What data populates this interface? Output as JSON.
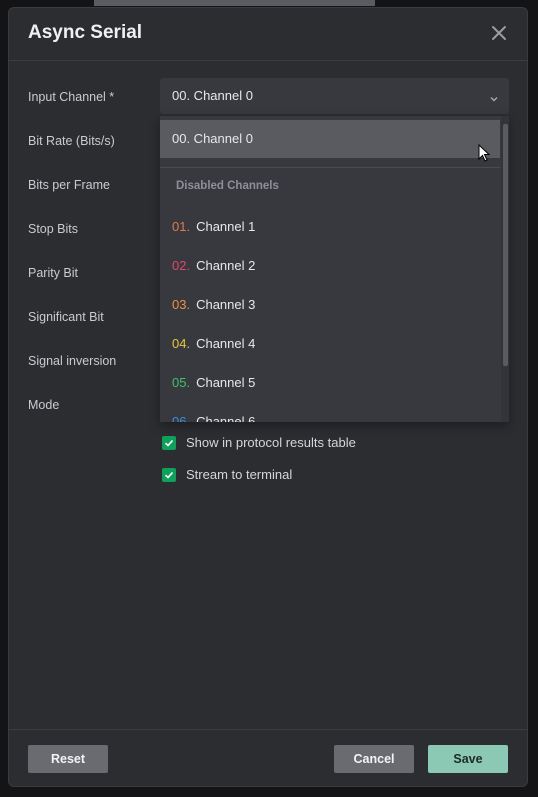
{
  "dialog": {
    "title": "Async Serial",
    "close_icon": "close-icon"
  },
  "form": {
    "labels": [
      "Input Channel *",
      "Bit Rate (Bits/s)",
      "Bits per Frame",
      "Stop Bits",
      "Parity Bit",
      "Significant Bit",
      "Signal inversion",
      "Mode"
    ],
    "input_channel": {
      "value": "00.  Channel 0",
      "chevron_icon": "chevron-down-icon"
    }
  },
  "dropdown": {
    "selected": "00.  Channel 0",
    "group_label": "Disabled Channels",
    "items": [
      {
        "num": "01.",
        "label": "Channel 1",
        "color": "#e07a4f"
      },
      {
        "num": "02.",
        "label": "Channel 2",
        "color": "#e2476a"
      },
      {
        "num": "03.",
        "label": "Channel 3",
        "color": "#e9953d"
      },
      {
        "num": "04.",
        "label": "Channel 4",
        "color": "#e6c63a"
      },
      {
        "num": "05.",
        "label": "Channel 5",
        "color": "#3dc36a"
      },
      {
        "num": "06.",
        "label": "Channel 6",
        "color": "#3c8fe0"
      }
    ]
  },
  "options": {
    "show_in_table": {
      "label": "Show in protocol results table",
      "checked": true
    },
    "stream_to_terminal": {
      "label": "Stream to terminal",
      "checked": true
    }
  },
  "footer": {
    "reset_label": "Reset",
    "cancel_label": "Cancel",
    "save_label": "Save"
  },
  "colors": {
    "accent_check": "#0fa05c",
    "save_button": "#8cc9b5"
  }
}
